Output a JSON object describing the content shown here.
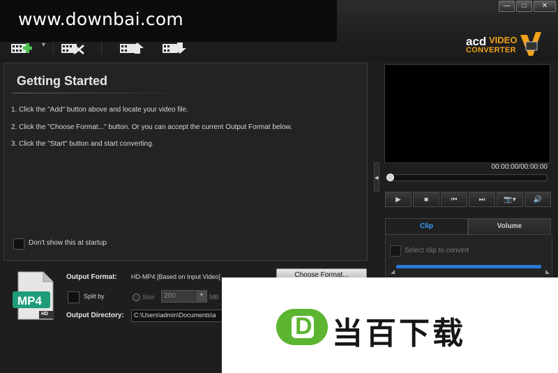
{
  "window": {
    "minimize_glyph": "—",
    "maximize_glyph": "□",
    "close_glyph": "✕"
  },
  "watermark": {
    "text": "www.downbai.com"
  },
  "toolbar": {
    "buttons": [
      {
        "icon": "add-video-icon"
      },
      {
        "icon": "remove-video-icon"
      },
      {
        "icon": "move-up-icon"
      },
      {
        "icon": "move-down-icon"
      }
    ],
    "add_dropdown_glyph": "▾"
  },
  "logo": {
    "acd": "acd",
    "video": "VIDEO",
    "converter": "CONVERTER"
  },
  "getting_started": {
    "title": "Getting Started",
    "steps": [
      "1.  Click the \"Add\" button above and locate your video file.",
      "2.  Click the \"Choose Format...\" button. Or you can accept the current Output Format below.",
      "3.  Click the \"Start\" button and start converting."
    ],
    "startup_label": "Don't show this at startup"
  },
  "preview": {
    "timecode": "00:00:00/00:00:00",
    "progress": 0
  },
  "controls": {
    "play": "▶",
    "stop": "■",
    "prev": "⏮",
    "next": "⏭",
    "snapshot": "📷▾",
    "volume": "🔊"
  },
  "tabs": {
    "clip": "Clip",
    "volume": "Volume"
  },
  "clip": {
    "select_label": "Select clip to convert"
  },
  "output": {
    "format_badge": "MP4",
    "format_label": "Output Format:",
    "format_value": "HD-MP4 [Based on Input Video]",
    "choose_format": "Choose Format...",
    "split_label": "Split by",
    "size_label": "Size",
    "size_value": "200",
    "size_unit": "MB",
    "directory_label": "Output Directory:",
    "directory_value": "C:\\Users\\admin\\Documents\\a"
  },
  "banner": {
    "logo_letter": "D",
    "text": "当百下载"
  },
  "colors": {
    "accent_blue": "#3aa0ff",
    "logo_orange": "#f3a11a",
    "banner_green": "#5cb531"
  }
}
